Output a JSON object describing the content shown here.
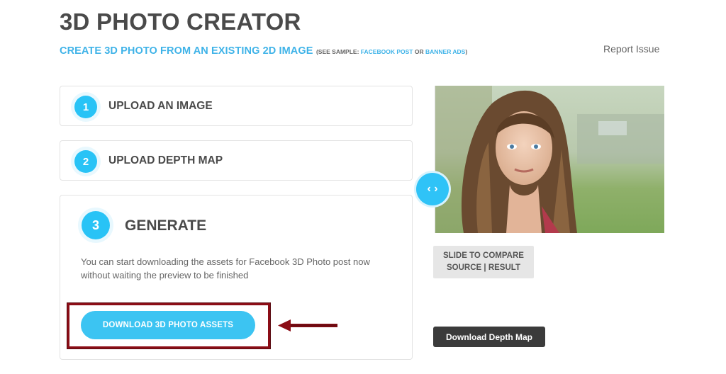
{
  "header": {
    "title": "3D PHOTO CREATOR",
    "subtitle": "CREATE 3D PHOTO FROM AN EXISTING 2D IMAGE",
    "sample_prefix": "(SEE SAMPLE:",
    "sample_link_1": "FACEBOOK POST",
    "sample_or": "OR",
    "sample_link_2": "BANNER ADS",
    "sample_suffix": ")",
    "report_issue": "Report Issue"
  },
  "steps": [
    {
      "number": "1",
      "label": "UPLOAD AN IMAGE"
    },
    {
      "number": "2",
      "label": "UPLOAD DEPTH MAP"
    },
    {
      "number": "3",
      "label": "GENERATE"
    }
  ],
  "generate": {
    "description_line1": "You can start downloading the assets for Facebook 3D Photo post now",
    "description_line2": "without waiting the preview to be finished",
    "download_button": "DOWNLOAD 3D PHOTO ASSETS"
  },
  "preview": {
    "slider_glyph": "‹ ›",
    "compare_line1": "SLIDE TO COMPARE",
    "compare_line2": "SOURCE | RESULT",
    "depth_map_button": "Download Depth Map"
  },
  "colors": {
    "accent": "#28c3f6",
    "highlight": "#8b0d16",
    "dark_button": "#3b3b3b"
  }
}
